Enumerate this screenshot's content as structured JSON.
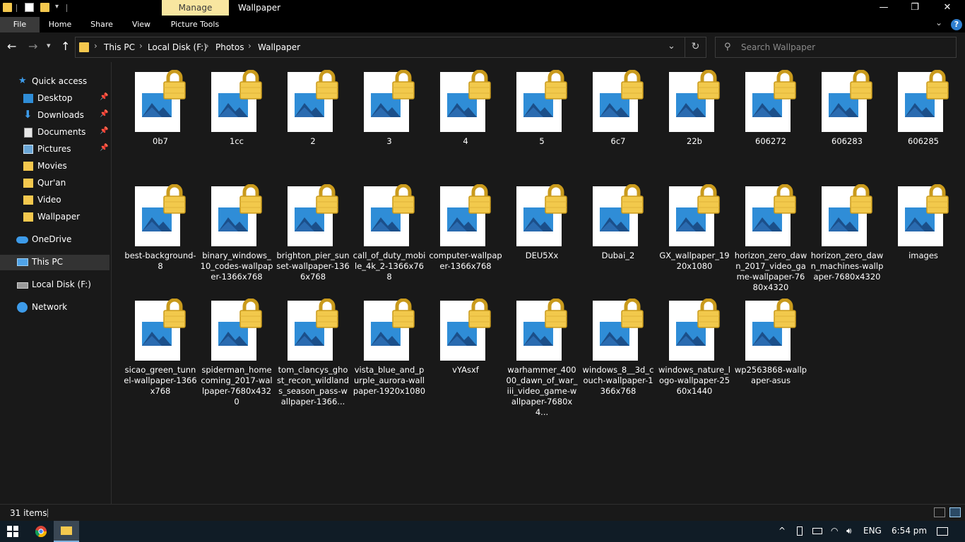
{
  "window": {
    "title": "Wallpaper",
    "contextual_tab": "Manage",
    "controls": {
      "minimize": "—",
      "maximize": "❐",
      "close": "✕"
    }
  },
  "ribbon": {
    "tabs": [
      "File",
      "Home",
      "Share",
      "View",
      "Picture Tools"
    ]
  },
  "address": {
    "crumbs": [
      "This PC",
      "Local Disk (F:)",
      "Photos",
      "Wallpaper"
    ]
  },
  "search": {
    "placeholder": "Search Wallpaper"
  },
  "sidebar": {
    "items": [
      {
        "label": "Quick access",
        "icon": "star-icon"
      },
      {
        "label": "Desktop",
        "icon": "desktop-icon",
        "pinned": true
      },
      {
        "label": "Downloads",
        "icon": "download-icon",
        "pinned": true
      },
      {
        "label": "Documents",
        "icon": "documents-icon",
        "pinned": true
      },
      {
        "label": "Pictures",
        "icon": "pictures-icon",
        "pinned": true
      },
      {
        "label": "Movies",
        "icon": "folder-icon"
      },
      {
        "label": "Qur'an",
        "icon": "folder-icon"
      },
      {
        "label": "Video",
        "icon": "folder-icon"
      },
      {
        "label": "Wallpaper",
        "icon": "folder-icon"
      },
      {
        "label": "OneDrive",
        "icon": "cloud-icon"
      },
      {
        "label": "This PC",
        "icon": "computer-icon",
        "selected": true
      },
      {
        "label": "Local Disk (F:)",
        "icon": "drive-icon"
      },
      {
        "label": "Network",
        "icon": "network-icon"
      }
    ]
  },
  "files": [
    {
      "name": "0b7"
    },
    {
      "name": "1cc"
    },
    {
      "name": "2"
    },
    {
      "name": "3"
    },
    {
      "name": "4"
    },
    {
      "name": "5"
    },
    {
      "name": "6c7"
    },
    {
      "name": "22b"
    },
    {
      "name": "606272"
    },
    {
      "name": "606283"
    },
    {
      "name": "606285"
    },
    {
      "name": "best-background-8"
    },
    {
      "name": "binary_windows_10_codes-wallpaper-1366x768"
    },
    {
      "name": "brighton_pier_sunset-wallpaper-1366x768"
    },
    {
      "name": "call_of_duty_mobile_4k_2-1366x768"
    },
    {
      "name": "computer-wallpaper-1366x768"
    },
    {
      "name": "DEU5Xx"
    },
    {
      "name": "Dubai_2"
    },
    {
      "name": "GX_wallpaper_1920x1080"
    },
    {
      "name": "horizon_zero_dawn_2017_video_game-wallpaper-7680x4320"
    },
    {
      "name": "horizon_zero_dawn_machines-wallpaper-7680x4320"
    },
    {
      "name": "images"
    },
    {
      "name": "sicao_green_tunnel-wallpaper-1366x768"
    },
    {
      "name": "spiderman_homecoming_2017-wallpaper-7680x4320"
    },
    {
      "name": "tom_clancys_ghost_recon_wildlands_season_pass-wallpaper-1366..."
    },
    {
      "name": "vista_blue_and_purple_aurora-wallpaper-1920x1080"
    },
    {
      "name": "vYAsxf"
    },
    {
      "name": "warhammer_40000_dawn_of_war_iii_video_game-wallpaper-7680x4..."
    },
    {
      "name": "windows_8__3d_couch-wallpaper-1366x768"
    },
    {
      "name": "windows_nature_logo-wallpaper-2560x1440"
    },
    {
      "name": "wp2563868-wallpaper-asus"
    }
  ],
  "status": {
    "count": "31 items"
  },
  "taskbar": {
    "language": "ENG",
    "time": "6:54 pm"
  },
  "colors": {
    "folder": "#f4c84e",
    "lock": "#f2c94c",
    "accent": "#2f8dd7",
    "background": "#191919"
  }
}
